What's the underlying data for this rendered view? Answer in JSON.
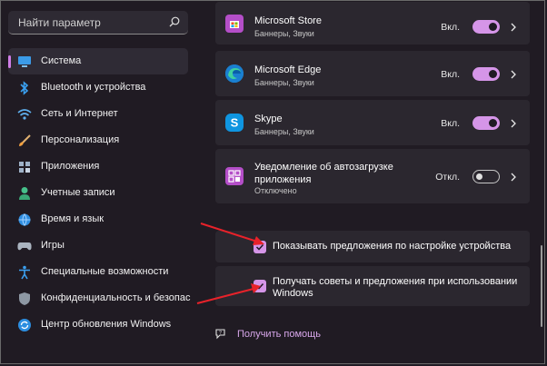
{
  "search": {
    "placeholder": "Найти параметр",
    "icon": "search-icon"
  },
  "sidebar": {
    "items": [
      {
        "label": "Система",
        "icon": "system-icon",
        "active": true
      },
      {
        "label": "Bluetooth и устройства",
        "icon": "bluetooth-icon"
      },
      {
        "label": "Сеть и Интернет",
        "icon": "wifi-icon"
      },
      {
        "label": "Персонализация",
        "icon": "brush-icon"
      },
      {
        "label": "Приложения",
        "icon": "apps-icon"
      },
      {
        "label": "Учетные записи",
        "icon": "accounts-icon"
      },
      {
        "label": "Время и язык",
        "icon": "time-language-icon"
      },
      {
        "label": "Игры",
        "icon": "gaming-icon"
      },
      {
        "label": "Специальные возможности",
        "icon": "accessibility-icon"
      },
      {
        "label": "Конфиденциальность и безопас",
        "icon": "privacy-shield-icon"
      },
      {
        "label": "Центр обновления Windows",
        "icon": "windows-update-icon"
      }
    ]
  },
  "apps": [
    {
      "name": "Microsoft Store",
      "sub": "Баннеры, Звуки",
      "state": "Вкл.",
      "on": true
    },
    {
      "name": "Microsoft Edge",
      "sub": "Баннеры, Звуки",
      "state": "Вкл.",
      "on": true
    },
    {
      "name": "Skype",
      "sub": "Баннеры, Звуки",
      "state": "Вкл.",
      "on": true
    },
    {
      "name": "Уведомление об автозагрузке приложения",
      "sub": "Отключено",
      "state": "Откл.",
      "on": false
    }
  ],
  "checkboxes": [
    {
      "label": "Показывать предложения по настройке устройства",
      "checked": true
    },
    {
      "label": "Получать советы и предложения при использовании Windows",
      "checked": true
    }
  ],
  "help": {
    "label": "Получить помощь"
  },
  "colors": {
    "accent": "#d595e8",
    "background": "#201b23",
    "card": "#2b272f",
    "arrow": "#e8222a"
  }
}
